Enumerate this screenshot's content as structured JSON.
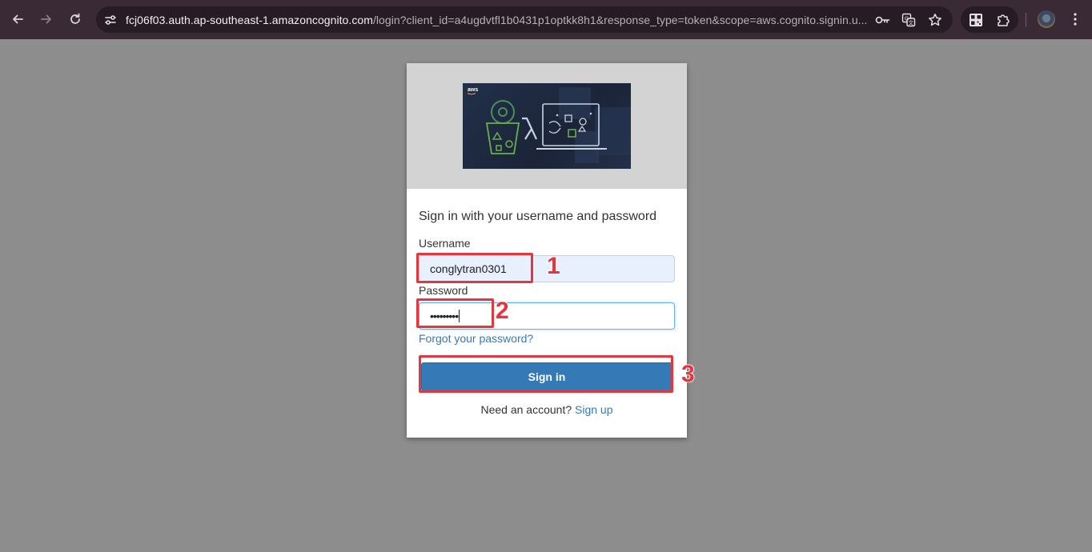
{
  "browser": {
    "url_host": "fcj06f03.auth.ap-southeast-1.amazoncognito.com",
    "url_path": "/login?client_id=a4ugdvtfl1b0431p1optkk8h1&response_type=token&scope=aws.cognito.signin.u..."
  },
  "logo": {
    "brand": "aws"
  },
  "form": {
    "title": "Sign in with your username and password",
    "username_label": "Username",
    "username_value": "conglytran0301",
    "password_label": "Password",
    "password_value": "•••••••••",
    "forgot_link": "Forgot your password?",
    "submit_label": "Sign in",
    "signup_prompt": "Need an account?",
    "signup_link": "Sign up"
  },
  "annotations": {
    "step1": "1",
    "step2": "2",
    "step3": "3",
    "color": "#e0383e"
  },
  "colors": {
    "page_bg": "#8d8d8d",
    "toolbar_bg": "#3a2a36",
    "button_primary": "#337ab7",
    "link": "#337ab7",
    "autofill_bg": "#e8f0fe"
  },
  "icons": [
    "back-arrow-icon",
    "forward-arrow-icon",
    "reload-icon",
    "site-info-icon",
    "password-key-icon",
    "translate-icon",
    "bookmark-star-icon",
    "qr-extension-icon",
    "extensions-puzzle-icon",
    "profile-avatar",
    "more-menu-icon"
  ]
}
